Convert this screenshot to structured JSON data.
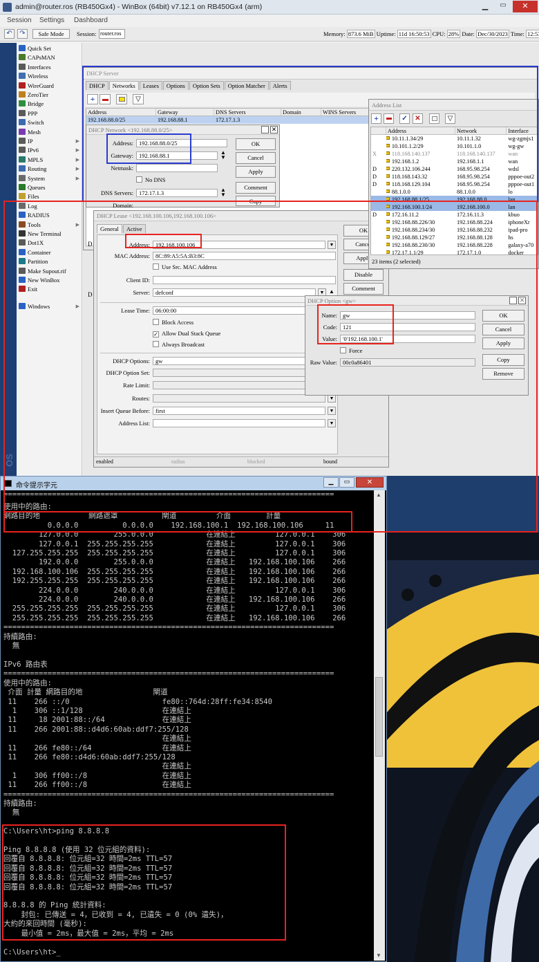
{
  "winbox": {
    "title": "admin@router.ros (RB450Gx4) - WinBox (64bit) v7.12.1 on RB450Gx4 (arm)",
    "menu": [
      "Session",
      "Settings",
      "Dashboard"
    ],
    "safe_mode": "Safe Mode",
    "session_label": "Session:",
    "session_value": "router.ros",
    "status": {
      "memory_label": "Memory:",
      "memory": "873.6 MiB",
      "uptime_label": "Uptime:",
      "uptime": "11d 16:50:53",
      "cpu_label": "CPU:",
      "cpu": "28%",
      "date_label": "Date:",
      "date": "Dec/30/2023",
      "time_label": "Time:",
      "time": "12:53"
    },
    "sidebar": [
      "Quick Set",
      "CAPsMAN",
      "Interfaces",
      "Wireless",
      "WireGuard",
      "ZeroTier",
      "Bridge",
      "PPP",
      "Switch",
      "Mesh",
      "IP",
      "IPv6",
      "MPLS",
      "Routing",
      "System",
      "Queues",
      "Files",
      "Log",
      "RADIUS",
      "Tools",
      "New Terminal",
      "Dot1X",
      "Container",
      "Partition",
      "Make Supout.rif",
      "New WinBox",
      "Exit",
      "Windows"
    ],
    "vertical_text": "OS"
  },
  "dhcp_server": {
    "title": "DHCP Server",
    "tabs": [
      "DHCP",
      "Networks",
      "Leases",
      "Options",
      "Option Sets",
      "Option Matcher",
      "Alerts"
    ],
    "columns": [
      "Address",
      "Gateway",
      "DNS Servers",
      "Domain",
      "WINS Servers"
    ],
    "row": [
      "192.168.88.0/25",
      "192.168.88.1",
      "172.17.1.3",
      "",
      ""
    ]
  },
  "dhcp_network": {
    "title": "DHCP Network <192.168.88.0/25>",
    "address_label": "Address:",
    "address": "192.168.88.0/25",
    "gateway_label": "Gateway:",
    "gateway": "192.168.88.1",
    "netmask_label": "Netmask:",
    "nodns_label": "No DNS",
    "dns_label": "DNS Servers:",
    "dns": "172.17.1.3",
    "domain_label": "Domain:",
    "buttons": [
      "OK",
      "Cancel",
      "Apply",
      "Comment",
      "Copy"
    ]
  },
  "dhcp_lease": {
    "title": "DHCP Lease <192.168.100.106,192.168.100.106>",
    "tabs": [
      "General",
      "Active"
    ],
    "address_label": "Address:",
    "address": "192.168.100.106",
    "mac_label": "MAC Address:",
    "mac": "8C:89:A5:5A:B3:8C",
    "usemac_label": "Use Src. MAC Address",
    "clientid_label": "Client ID:",
    "server_label": "Server:",
    "server": "defconf",
    "leasetime_label": "Lease Time:",
    "leasetime": "06:00:00",
    "block_label": "Block Access",
    "dual_label": "Allow Dual Stack Queue",
    "broadcast_label": "Always Broadcast",
    "dhcpopt_label": "DHCP Options:",
    "dhcpopt": "gw",
    "optset_label": "DHCP Option Set:",
    "ratelimit_label": "Rate Limit:",
    "routes_label": "Routes:",
    "queue_label": "Insert Queue Before:",
    "queue": "first",
    "addrlist_label": "Address List:",
    "status": [
      "enabled",
      "radius",
      "blocked",
      "bound"
    ],
    "buttons": [
      "OK",
      "Cancel",
      "Apply",
      "Disable",
      "Comment"
    ],
    "side_letters": [
      "D",
      "D"
    ]
  },
  "dhcp_option": {
    "title": "DHCP Option <gw>",
    "name_label": "Name:",
    "name": "gw",
    "code_label": "Code:",
    "code": "121",
    "value_label": "Value:",
    "value": "'0'192.168.100.1'",
    "force_label": "Force",
    "raw_label": "Raw Value:",
    "raw": "00c0a86401",
    "buttons": [
      "OK",
      "Cancel",
      "Apply",
      "Copy",
      "Remove"
    ]
  },
  "address_list": {
    "title": "Address List",
    "columns": [
      "Address",
      "Network",
      "Interface"
    ],
    "rows": [
      {
        "flag": "",
        "addr": "10.11.1.34/29",
        "net": "10.11.1.32",
        "iface": "wg-zgmjs1",
        "dim": false,
        "sel": false
      },
      {
        "flag": "",
        "addr": "10.101.1.2/29",
        "net": "10.101.1.0",
        "iface": "wg-gw",
        "dim": false,
        "sel": false
      },
      {
        "flag": "X",
        "addr": "118.168.140.137",
        "net": "118.168.140.137",
        "iface": "wan",
        "dim": true,
        "sel": false
      },
      {
        "flag": "",
        "addr": "192.168.1.2",
        "net": "192.168.1.1",
        "iface": "wan",
        "dim": false,
        "sel": false
      },
      {
        "flag": "D",
        "addr": "220.132.106.244",
        "net": "168.95.98.254",
        "iface": "wdsl",
        "dim": false,
        "sel": false
      },
      {
        "flag": "D",
        "addr": "118.168.143.32",
        "net": "168.95.98.254",
        "iface": "pppoe-out2",
        "dim": false,
        "sel": false
      },
      {
        "flag": "D",
        "addr": "118.168.129.104",
        "net": "168.95.98.254",
        "iface": "pppoe-out1",
        "dim": false,
        "sel": false
      },
      {
        "flag": "",
        "addr": "88.1.0.0",
        "net": "88.1.0.0",
        "iface": "lo",
        "dim": false,
        "sel": false
      },
      {
        "flag": "",
        "addr": "192.168.88.1/25",
        "net": "192.168.88.0",
        "iface": "lan",
        "dim": false,
        "sel": true
      },
      {
        "flag": "",
        "addr": "192.168.100.1/24",
        "net": "192.168.100.0",
        "iface": "lan",
        "dim": false,
        "sel": true
      },
      {
        "flag": "D",
        "addr": "172.16.11.2",
        "net": "172.16.11.3",
        "iface": "kbuo",
        "dim": false,
        "sel": false
      },
      {
        "flag": "",
        "addr": "192.168.88.226/30",
        "net": "192.168.88.224",
        "iface": "iphoneXr",
        "dim": false,
        "sel": false
      },
      {
        "flag": "",
        "addr": "192.168.88.234/30",
        "net": "192.168.88.232",
        "iface": "ipad-pro",
        "dim": false,
        "sel": false
      },
      {
        "flag": "",
        "addr": "192.168.88.129/27",
        "net": "192.168.88.128",
        "iface": "hs",
        "dim": false,
        "sel": false
      },
      {
        "flag": "",
        "addr": "192.168.88.230/30",
        "net": "192.168.88.228",
        "iface": "galaxy-a70",
        "dim": false,
        "sel": false
      },
      {
        "flag": "",
        "addr": "172.17.1.1/29",
        "net": "172.17.1.0",
        "iface": "docker",
        "dim": false,
        "sel": false
      }
    ],
    "footer": "23 items (2 selected)"
  },
  "cmd": {
    "title": "命令提示字元",
    "lines": [
      "使用中的路由:",
      "網路目的地           網路遮罩          閘道         介面        計量",
      "          0.0.0.0          0.0.0.0    192.168.100.1  192.168.100.106     11",
      "        127.0.0.0        255.0.0.0            在連結上         127.0.0.1    306",
      "        127.0.0.1  255.255.255.255            在連結上         127.0.0.1    306",
      "  127.255.255.255  255.255.255.255            在連結上         127.0.0.1    306",
      "        192.0.0.0        255.0.0.0            在連結上   192.168.100.106    266",
      "  192.168.100.106  255.255.255.255            在連結上   192.168.100.106    266",
      "  192.255.255.255  255.255.255.255            在連結上   192.168.100.106    266",
      "        224.0.0.0        240.0.0.0            在連結上         127.0.0.1    306",
      "        224.0.0.0        240.0.0.0            在連結上   192.168.100.106    266",
      "  255.255.255.255  255.255.255.255            在連結上         127.0.0.1    306",
      "  255.255.255.255  255.255.255.255            在連結上   192.168.100.106    266",
      "===========================================================================",
      "持續路由:",
      "  無",
      "",
      "IPv6 路由表",
      "===========================================================================",
      "使用中的路由:",
      " 介面 計量 網路目的地                閘道",
      " 11    266 ::/0                     fe80::764d:28ff:fe34:8540",
      "  1    306 ::1/128                  在連結上",
      " 11     18 2001:88::/64             在連結上",
      " 11    266 2001:88::d4d6:60ab:ddf7:255/128",
      "                                    在連結上",
      " 11    266 fe80::/64                在連結上",
      " 11    266 fe80::d4d6:60ab:ddf7:255/128",
      "                                    在連結上",
      "  1    306 ff00::/8                 在連結上",
      " 11    266 ff00::/8                 在連結上",
      "===========================================================================",
      "持續路由:",
      "  無",
      "",
      "C:\\Users\\ht>ping 8.8.8.8",
      "",
      "Ping 8.8.8.8 (使用 32 位元組的資料):",
      "回覆自 8.8.8.8: 位元組=32 時間=2ms TTL=57",
      "回覆自 8.8.8.8: 位元組=32 時間=2ms TTL=57",
      "回覆自 8.8.8.8: 位元組=32 時間=2ms TTL=57",
      "回覆自 8.8.8.8: 位元組=32 時間=2ms TTL=57",
      "",
      "8.8.8.8 的 Ping 統計資料:",
      "    封包: 已傳送 = 4，已收到 = 4, 已遺失 = 0 (0% 遺失)，",
      "大約的來回時間 (毫秒):",
      "    最小值 = 2ms，最大值 = 2ms，平均 = 2ms",
      "",
      "C:\\Users\\ht>_"
    ]
  }
}
